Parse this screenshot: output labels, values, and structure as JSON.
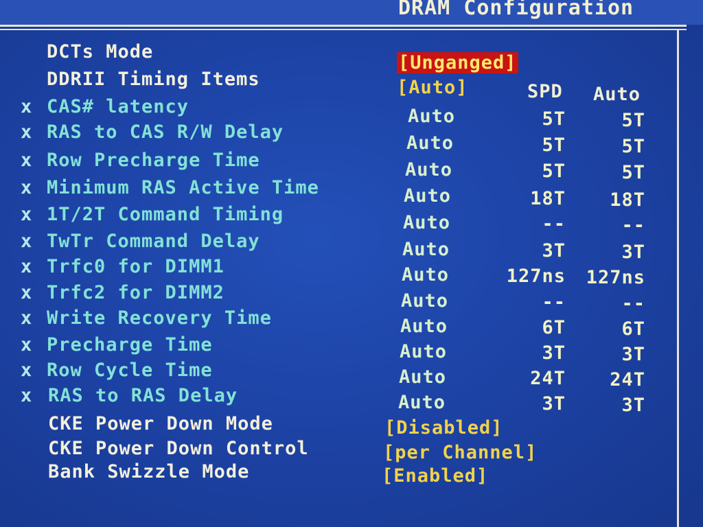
{
  "title": "DRAM Configuration",
  "headers": {
    "spd": "SPD",
    "auto": "Auto"
  },
  "top_items": [
    {
      "label": "DCTs Mode",
      "value": "[Unganged]"
    },
    {
      "label": "DDRII Timing Items",
      "value": "[Auto]"
    }
  ],
  "timings": [
    {
      "mark": "x",
      "label": "CAS# latency",
      "value": "Auto",
      "spd": "5T",
      "auto": "5T"
    },
    {
      "mark": "x",
      "label": "RAS to CAS R/W Delay",
      "value": "Auto",
      "spd": "5T",
      "auto": "5T"
    },
    {
      "mark": "x",
      "label": "Row Precharge Time",
      "value": "Auto",
      "spd": "5T",
      "auto": "5T"
    },
    {
      "mark": "x",
      "label": "Minimum RAS Active Time",
      "value": "Auto",
      "spd": "18T",
      "auto": "18T"
    },
    {
      "mark": "x",
      "label": "1T/2T Command Timing",
      "value": "Auto",
      "spd": "--",
      "auto": "--"
    },
    {
      "mark": "x",
      "label": "TwTr Command Delay",
      "value": "Auto",
      "spd": "3T",
      "auto": "3T"
    },
    {
      "mark": "x",
      "label": "Trfc0 for DIMM1",
      "value": "Auto",
      "spd": "127ns",
      "auto": "127ns"
    },
    {
      "mark": "x",
      "label": "Trfc2 for DIMM2",
      "value": "Auto",
      "spd": "--",
      "auto": "--"
    },
    {
      "mark": "x",
      "label": "Write Recovery Time",
      "value": "Auto",
      "spd": "6T",
      "auto": "6T"
    },
    {
      "mark": "x",
      "label": "Precharge Time",
      "value": "Auto",
      "spd": "3T",
      "auto": "3T"
    },
    {
      "mark": "x",
      "label": "Row Cycle Time",
      "value": "Auto",
      "spd": "24T",
      "auto": "24T"
    },
    {
      "mark": "x",
      "label": "RAS to RAS Delay",
      "value": "Auto",
      "spd": "3T",
      "auto": "3T"
    }
  ],
  "bottom_items": [
    {
      "label": "CKE Power Down Mode",
      "value": "[Disabled]"
    },
    {
      "label": "CKE Power Down Control",
      "value": "[per Channel]"
    },
    {
      "label": "Bank Swizzle Mode",
      "value": "[Enabled]"
    }
  ]
}
